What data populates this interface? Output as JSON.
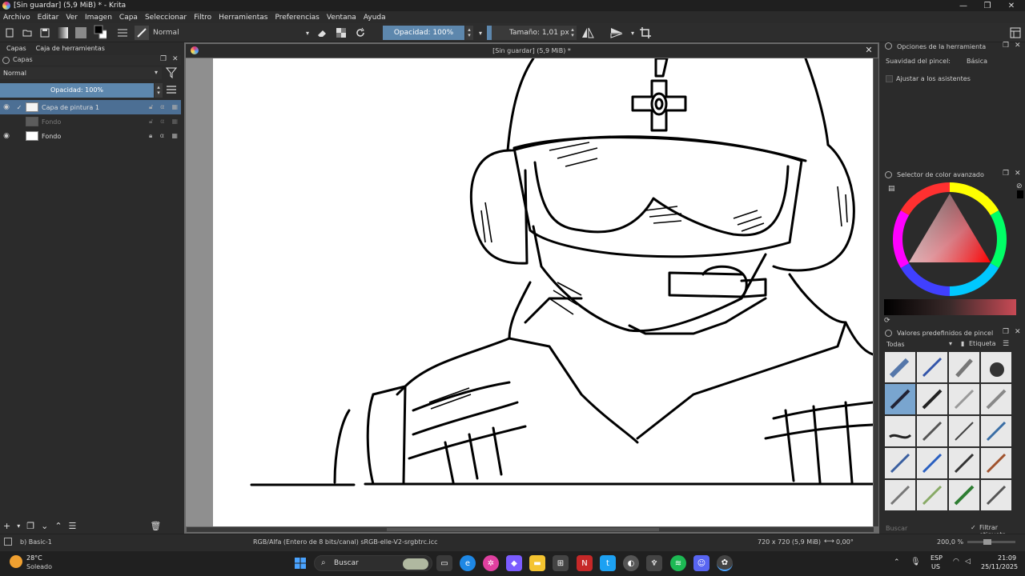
{
  "window": {
    "title": "[Sin guardar]  (5,9 MiB) * - Krita",
    "minimize": "—",
    "maximize": "❐",
    "close": "✕"
  },
  "menu": [
    "Archivo",
    "Editar",
    "Ver",
    "Imagen",
    "Capa",
    "Seleccionar",
    "Filtro",
    "Herramientas",
    "Preferencias",
    "Ventana",
    "Ayuda"
  ],
  "toolbar": {
    "blend_mode": "Normal",
    "opacity": "Opacidad: 100%",
    "size": "Tamaño: 1,01 px"
  },
  "left_panel": {
    "tabs": [
      "Capas",
      "Caja de herramientas"
    ],
    "header": "Capas",
    "blend_mode": "Normal",
    "opacity": "Opacidad:  100%",
    "layers": [
      {
        "name": "Capa de pintura 1",
        "selected": true
      },
      {
        "name": "Fondo",
        "selected": false
      },
      {
        "name": "Fondo",
        "selected": false
      }
    ]
  },
  "document": {
    "tab_title": "[Sin guardar]  (5,9 MiB) *"
  },
  "right_panel": {
    "tool_options": {
      "header": "Opciones de la herramienta",
      "smoothing_label": "Suavidad del pincel:",
      "smoothing_value": "Básica",
      "assistants_label": "Ajustar a los asistentes"
    },
    "color_selector": {
      "header": "Selector de color avanzado"
    },
    "brush_presets": {
      "header": "Valores predefinidos de pincel",
      "filter": "Todas",
      "tag": "Etiqueta",
      "search_placeholder": "Buscar",
      "filter_tag": "Filtrar etiqueta"
    }
  },
  "status": {
    "brush": "b) Basic-1",
    "color_space": "RGB/Alfa (Entero de 8 bits/canal)  sRGB-elle-V2-srgbtrc.icc",
    "dimensions": "720 x 720 (5,9 MiB)",
    "rotation": "0,00°",
    "zoom": "200,0 %"
  },
  "taskbar": {
    "weather_temp": "28°C",
    "weather_desc": "Soleado",
    "search": "Buscar",
    "lang_top": "ESP",
    "lang_bottom": "US",
    "time": "21:09",
    "date": "25/11/2025"
  },
  "colors": {
    "accent": "#5d87ad",
    "panel_bg": "#2b2b2b",
    "canvas_bg": "#ffffff"
  }
}
